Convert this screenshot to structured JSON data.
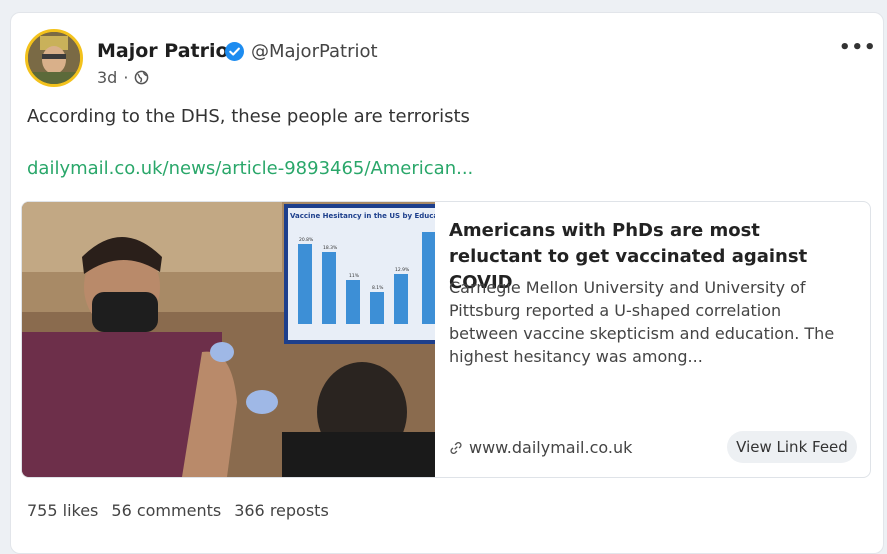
{
  "post": {
    "author_name": "Major Patriot",
    "handle": "@MajorPatriot",
    "time": "3d",
    "separator": "·",
    "text": "According to the DHS, these people are terrorists",
    "link": "dailymail.co.uk/news/article-9893465/American...",
    "more_label": "•••"
  },
  "preview": {
    "title": "Americans with PhDs are most reluctant to get vaccinated against COVID",
    "description": "Carnegie Mellon University and University of Pittsburg reported a U-shaped correlation between vaccine skepticism and education. The highest hesitancy was among...",
    "domain": "www.dailymail.co.uk",
    "button_label": "View Link Feed",
    "image_chart_title": "Vaccine Hesitancy in the US by Education Le",
    "image_bar_labels": [
      "20.8%",
      "18.3%",
      "11%",
      "8.1%",
      "12.9%"
    ]
  },
  "stats": {
    "likes": "755 likes",
    "comments": "56 comments",
    "reposts": "366 reposts"
  },
  "colors": {
    "link": "#2aa76a",
    "verified": "#1d8cf0",
    "avatar_ring": "#f3c21c"
  },
  "icons": {
    "verified": "verified-badge-icon",
    "globe": "globe-icon",
    "link": "link-icon",
    "more": "more-options-icon"
  }
}
